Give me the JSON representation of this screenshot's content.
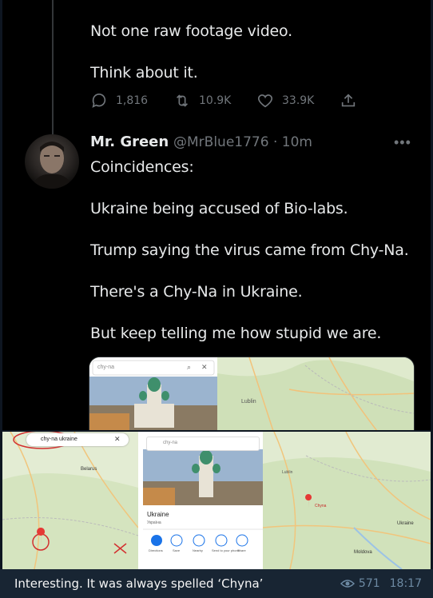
{
  "tweet_prev": {
    "line1": "Not one raw footage video.",
    "line2": "Think about it.",
    "replies": "1,816",
    "retweets": "10.9K",
    "likes": "33.9K"
  },
  "tweet": {
    "name": "Mr. Green",
    "handle": "@MrBlue1776 · 10m",
    "lines": [
      "Coincidences:",
      "Ukraine being accused of Bio-labs.",
      "Trump saying the virus came from Chy-Na.",
      "There's a Chy-Na in Ukraine.",
      "But keep telling me how stupid we are."
    ],
    "search_text": "chy-na"
  },
  "screenshot": {
    "search_left": "chy-na ukraine",
    "search_right": "chy-na",
    "map_labels": [
      "Belarus",
      "Lublin",
      "Ukraine",
      "Moldova",
      "Chyna"
    ],
    "place_title": "Ukraine",
    "place_subtitle": "Україна",
    "place_actions": [
      "Directions",
      "Save",
      "Nearby",
      "Send to your phone",
      "Share"
    ]
  },
  "caption": {
    "text": "Interesting. It was always spelled ‘Chyna’",
    "views": "571",
    "time": "18:17"
  },
  "colors": {
    "tweet_bg": "#000000",
    "tweet_text": "#e7e9ea",
    "muted": "#71767b",
    "telegram_bg": "#182533"
  }
}
